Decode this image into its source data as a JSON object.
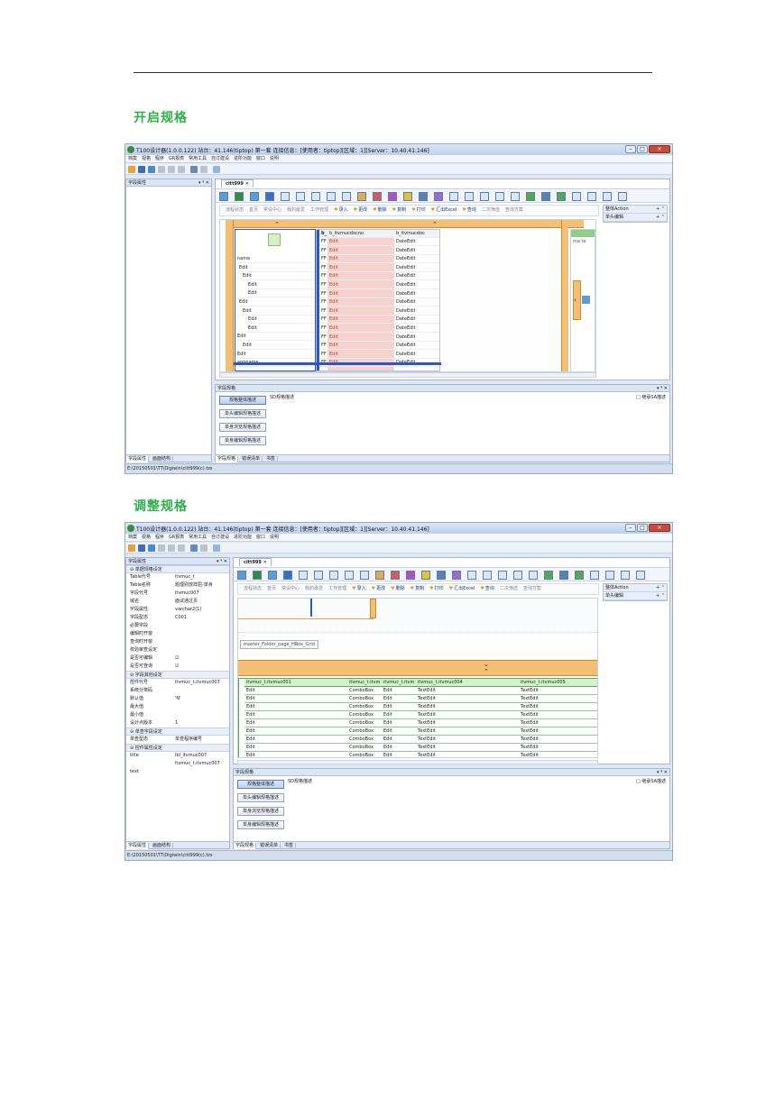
{
  "section1_title": "开启规格",
  "section2_title": "调整规格",
  "window": {
    "title": "T100设计器(1.0.0.122) 站台：41.146(tiptop) 第一套 连接信息：[使用者：tiptop][区域：1][Server：10.40.41.146]",
    "menu": [
      "档案",
      "视格",
      "程序",
      "GR报表",
      "常用工具",
      "自订建设",
      "进阶功能",
      "窗口",
      "说明"
    ],
    "doc_tab": "citt999",
    "status_path": "E:\\20150501\\TT\\Digiwin\\citt999(c).tzs"
  },
  "actions": [
    "流程状态",
    "首页",
    "常设中心",
    "我的最爱",
    "工作管理",
    "录入",
    "更改",
    "删除",
    "复制",
    "打印",
    "汇出Excel",
    "查询",
    "二次筛选",
    "查询方案"
  ],
  "active_actions": [
    "录入",
    "更改",
    "删除",
    "复制",
    "打印",
    "汇出Excel",
    "查询"
  ],
  "right_panel": [
    "整体Action",
    "单头编辑"
  ],
  "screen1": {
    "left_panel_title": "字段属性",
    "left_tabs": [
      "字段属性",
      "画面结构"
    ],
    "tree_items": [
      "name",
      "Edit",
      "Edit",
      "Edit",
      "Edit",
      "Edit",
      "Edit",
      "Edit",
      "Edit",
      "Edit",
      "Edit",
      "Edit",
      "appname"
    ],
    "grid_headers": [
      "b_",
      "b_itvmucdocno",
      "b_itvmucdoc"
    ],
    "grid_prefix": "FF",
    "grid_col1": "Edit",
    "grid_col2": "DateEdit",
    "grid_rows": 15,
    "side_fragment": "ma te",
    "lower_title": "字段规格",
    "lower_buttons": [
      "规格整体描述",
      "单头编辑规格描述",
      "单身浏览规格描述",
      "单身编辑规格描述"
    ],
    "lower_label": "SD规格描述",
    "lower_check": "继承SA描述",
    "lower_tabs": [
      "字段规格",
      "错误清单",
      "书签"
    ]
  },
  "screen2": {
    "left_panel_title": "字段属性",
    "sections": [
      "单据规格设定",
      "字段其他设定",
      "单查字段设定",
      "控件属性设定"
    ],
    "props": [
      {
        "k": "Table代号",
        "v": "itvmuc_t"
      },
      {
        "k": "Table名称",
        "v": "题理别放样屈-单身"
      },
      {
        "k": "字段代号",
        "v": "itvmuc007"
      },
      {
        "k": "域名",
        "v": "面试通过页"
      },
      {
        "k": "字段属性",
        "v": "varchar2(1)"
      },
      {
        "k": "字段型态",
        "v": "C001"
      },
      {
        "k": "必要字段",
        "v": ""
      },
      {
        "k": "编辑时开窗",
        "v": ""
      },
      {
        "k": "查询时开窗",
        "v": ""
      },
      {
        "k": "校验审查设定",
        "v": ""
      },
      {
        "k": "是否可编辑",
        "v": "☑"
      },
      {
        "k": "是否可查询",
        "v": "☑"
      }
    ],
    "props2": [
      {
        "k": "控件代号",
        "v": "itvmuc_t.itvmuc007"
      },
      {
        "k": "系统分类码",
        "v": ""
      },
      {
        "k": "默认值",
        "v": "'N'"
      },
      {
        "k": "最大值",
        "v": ""
      },
      {
        "k": "最小值",
        "v": ""
      },
      {
        "k": "设计点版本",
        "v": "1"
      }
    ],
    "props3": [
      {
        "k": "单查型态",
        "v": "单查程序编号"
      }
    ],
    "props4": [
      {
        "k": "title",
        "v": "lbl_itvmuc007"
      },
      {
        "k": "",
        "v": "itvmuc_t.itvmuc007"
      },
      {
        "k": "text",
        "v": ""
      }
    ],
    "left_tabs": [
      "字段属性",
      "画面结构"
    ],
    "tooltip": "master_Folder_page_HRox_Grid",
    "grid_headers": [
      "itvmuc_t.itvmuc001",
      "itvmuc_t.itvm",
      "itvmuc_t.itvm",
      "itvmuc_t.itvmuc004",
      "itvmuc_t.itvmuc005"
    ],
    "grid_row": [
      "Edit",
      "ComboBox",
      "Edit",
      "TextEdit",
      "TextEdit"
    ],
    "grid_rows": 9,
    "lower_title": "字段规格",
    "lower_buttons": [
      "规格整体描述",
      "单头编辑规格描述",
      "单身浏览规格描述",
      "单身编辑规格描述"
    ],
    "lower_label": "SD规格描述",
    "lower_check": "继承SA描述",
    "lower_tabs": [
      "字段规格",
      "错误清单",
      "书签"
    ]
  }
}
